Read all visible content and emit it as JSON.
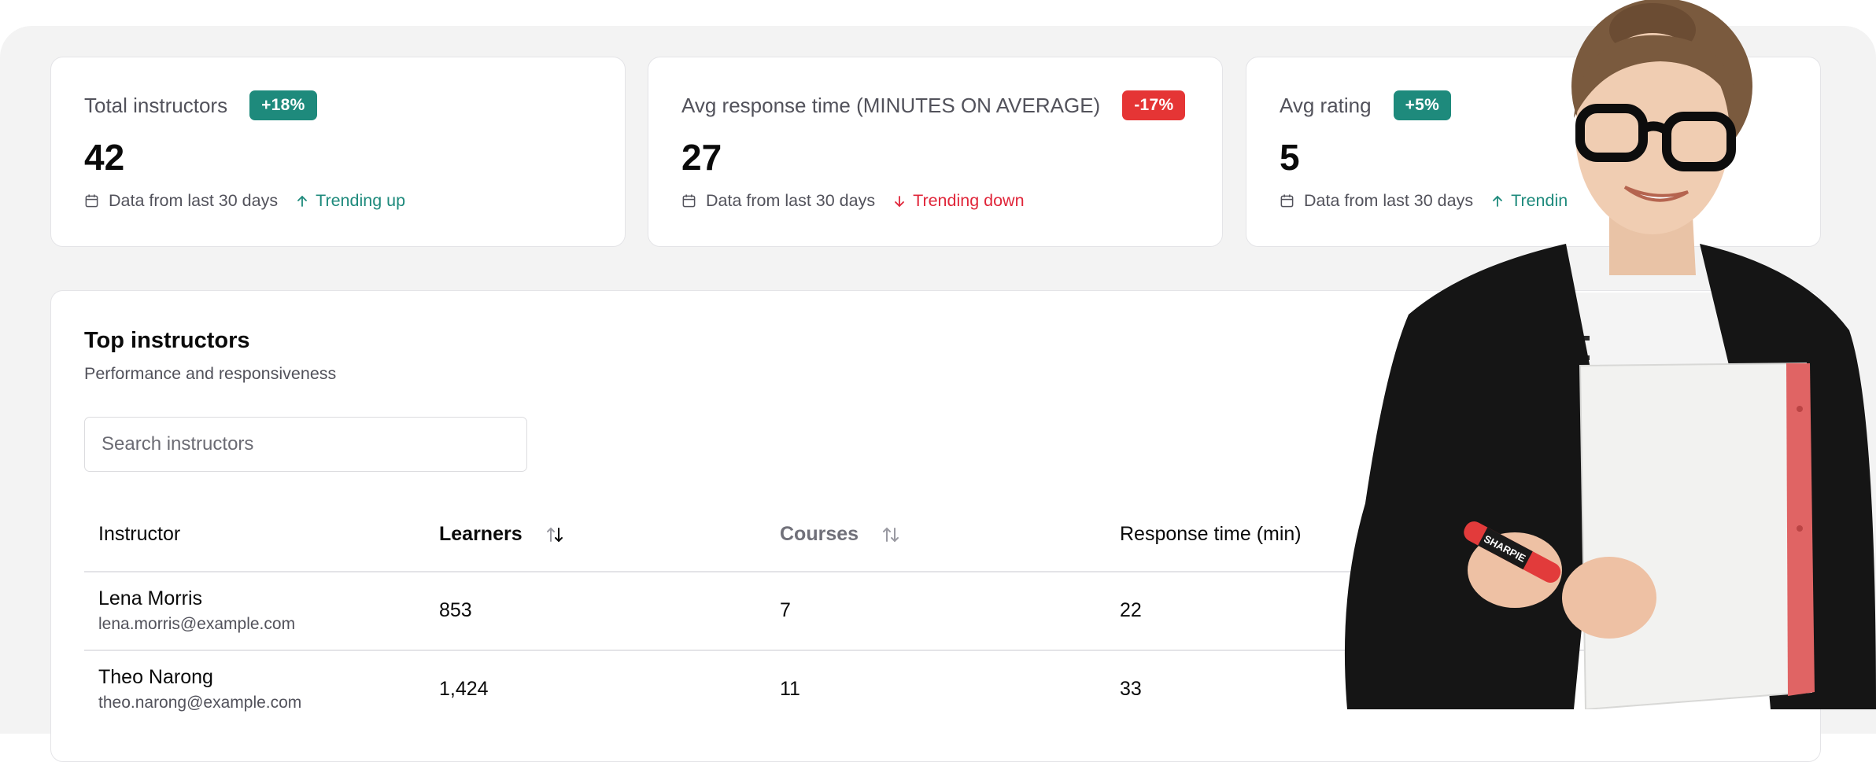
{
  "stats": [
    {
      "label": "Total instructors",
      "badge": "+18%",
      "value": "42",
      "period": "Data from last 30 days",
      "trend": "Trending up"
    },
    {
      "label": "Avg response time (MINUTES ON AVERAGE)",
      "badge": "-17%",
      "value": "27",
      "period": "Data from last 30 days",
      "trend": "Trending down"
    },
    {
      "label": "Avg rating",
      "badge": "+5%",
      "value": "5",
      "period": "Data from last 30 days",
      "trend": "Trendin"
    }
  ],
  "table": {
    "title": "Top instructors",
    "subtitle": "Performance and responsiveness",
    "search_placeholder": "Search instructors",
    "columns": [
      "Instructor",
      "Learners",
      "Courses",
      "Response time (min)"
    ],
    "rows": [
      {
        "name": "Lena Morris",
        "email": "lena.morris@example.com",
        "learners": "853",
        "courses": "7",
        "response": "22"
      },
      {
        "name": "Theo Narong",
        "email": "theo.narong@example.com",
        "learners": "1,424",
        "courses": "11",
        "response": "33"
      }
    ]
  },
  "marker_text": "SHARPIE",
  "colors": {
    "positive": "#1e8a7c",
    "negative": "#e53535",
    "background": "#f3f3f3"
  }
}
